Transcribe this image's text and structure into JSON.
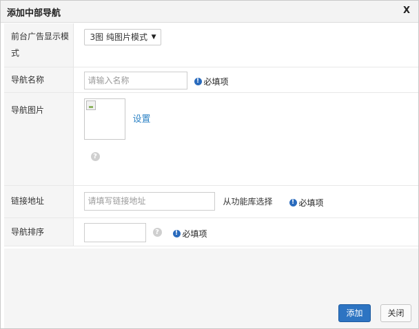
{
  "dialog": {
    "title": "添加中部导航",
    "close_label": "X"
  },
  "form": {
    "mode": {
      "label": "前台广告显示模式",
      "selected": "3图 纯图片模式"
    },
    "name": {
      "label": "导航名称",
      "placeholder": "请输入名称",
      "required": "必填项"
    },
    "image": {
      "label": "导航图片",
      "set_link": "设置"
    },
    "link": {
      "label": "链接地址",
      "placeholder": "请填写链接地址",
      "library_link": "从功能库选择",
      "required": "必填项"
    },
    "sort": {
      "label": "导航排序",
      "value": "",
      "required": "必填项"
    }
  },
  "footer": {
    "add_button": "添加",
    "close_button": "关闭"
  },
  "icons": {
    "info": "info-icon",
    "help": "help-icon",
    "dropdown": "dropdown-arrow-icon"
  },
  "colors": {
    "primary": "#2d74c2",
    "link": "#2f84c6",
    "info": "#2a6bbd"
  }
}
